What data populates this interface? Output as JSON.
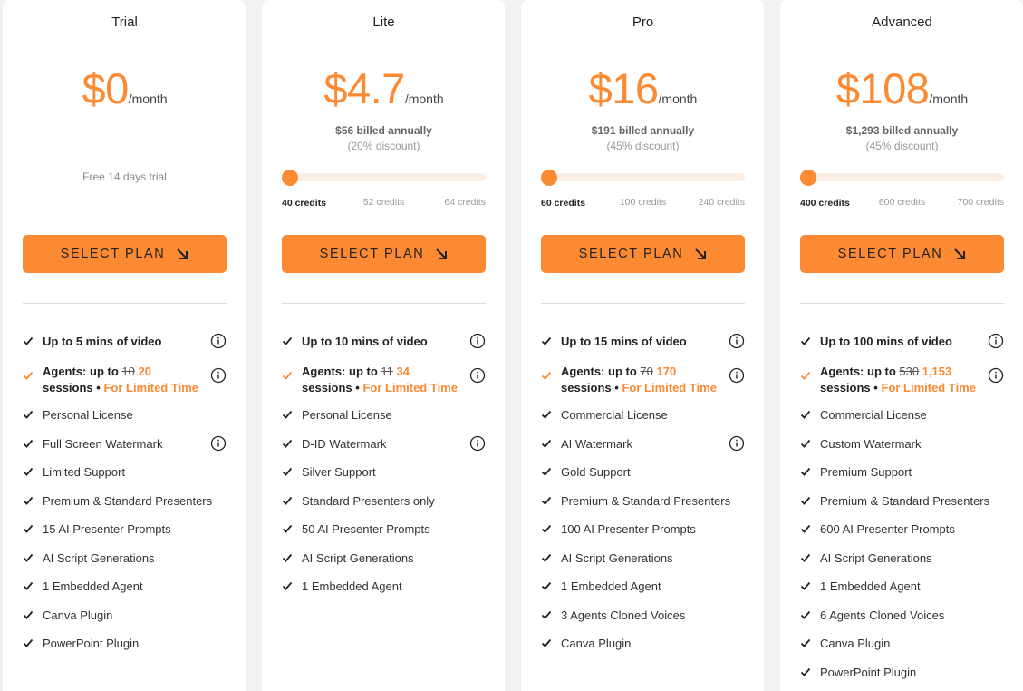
{
  "button_label": "SELECT PLAN",
  "colors": {
    "accent": "#fb8a33",
    "track": "#fdeee3"
  },
  "icons": {
    "check": "check-icon",
    "info": "info-icon",
    "button": "arrow-down-right-icon"
  },
  "plans": [
    {
      "name": "Trial",
      "price": "$0",
      "per": "/month",
      "trial_text": "Free 14 days trial",
      "features": [
        "Up to 5 mins of video",
        "Personal License",
        "Full Screen Watermark",
        "Limited Support",
        "Premium & Standard Presenters",
        "15 AI Presenter Prompts",
        "AI Script Generations",
        "1 Embedded Agent",
        "Canva Plugin",
        "PowerPoint Plugin"
      ],
      "agents": {
        "prefix": "Agents: up to",
        "old": "10",
        "new": "20",
        "line2": "sessions",
        "bullet": "•",
        "limited": "For Limited Time"
      }
    },
    {
      "name": "Lite",
      "price": "$4.7",
      "per": "/month",
      "billed": "$56 billed annually",
      "discount": "(20% discount)",
      "slider_value": 0,
      "credits": [
        "40 credits",
        "52 credits",
        "64 credits"
      ],
      "features": [
        "Up to 10 mins of video",
        "Personal License",
        "D-ID Watermark",
        "Silver Support",
        "Standard Presenters only",
        "50 AI Presenter Prompts",
        "AI Script Generations",
        "1 Embedded Agent"
      ],
      "agents": {
        "prefix": "Agents: up to",
        "old": "11",
        "new": "34",
        "line2": "sessions",
        "bullet": "•",
        "limited": "For Limited Time"
      }
    },
    {
      "name": "Pro",
      "price": "$16",
      "per": "/month",
      "billed": "$191 billed annually",
      "discount": "(45% discount)",
      "slider_value": 0,
      "credits": [
        "60 credits",
        "100 credits",
        "240 credits"
      ],
      "features": [
        "Up to 15 mins of video",
        "Commercial License",
        "AI Watermark",
        "Gold Support",
        "Premium & Standard Presenters",
        "100 AI Presenter Prompts",
        "AI Script Generations",
        "1 Embedded Agent",
        "3 Agents Cloned Voices",
        "Canva Plugin"
      ],
      "agents": {
        "prefix": "Agents: up to",
        "old": "70",
        "new": "170",
        "line2": "sessions",
        "bullet": "•",
        "limited": "For Limited Time"
      }
    },
    {
      "name": "Advanced",
      "price": "$108",
      "per": "/month",
      "billed": "$1,293 billed annually",
      "discount": "(45% discount)",
      "slider_value": 0,
      "credits": [
        "400 credits",
        "600 credits",
        "700 credits"
      ],
      "features": [
        "Up to 100 mins of video",
        "Commercial License",
        "Custom Watermark",
        "Premium Support",
        "Premium & Standard Presenters",
        "600 AI Presenter Prompts",
        "AI Script Generations",
        "1 Embedded Agent",
        "6 Agents Cloned Voices",
        "Canva Plugin",
        "PowerPoint Plugin"
      ],
      "agents": {
        "prefix": "Agents: up to",
        "old": "530",
        "new": "1,153",
        "line2": "sessions",
        "bullet": "•",
        "limited": "For Limited Time"
      }
    }
  ]
}
